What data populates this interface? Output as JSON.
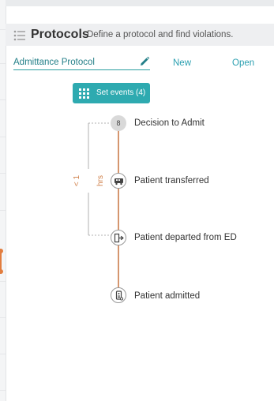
{
  "header": {
    "title": "Protocols",
    "subtitle": "Define a protocol and find violations."
  },
  "protocol": {
    "name": "Admittance Protocol",
    "new_label": "New",
    "open_label": "Open"
  },
  "set_events": {
    "label": "Set events (4)"
  },
  "timeline": {
    "constraint_label": "< 1 hrs",
    "events": [
      {
        "label": "Decision to Admit",
        "badge": "8",
        "icon": "count-badge"
      },
      {
        "label": "Patient transferred",
        "icon": "transport-icon"
      },
      {
        "label": "Patient departed from ED",
        "icon": "exit-icon"
      },
      {
        "label": "Patient admitted",
        "icon": "admission-icon"
      }
    ]
  },
  "colors": {
    "accent": "#2eaab0",
    "link": "#2a9fb0",
    "timeline": "#d5966f",
    "constraint": "#d0804a"
  }
}
